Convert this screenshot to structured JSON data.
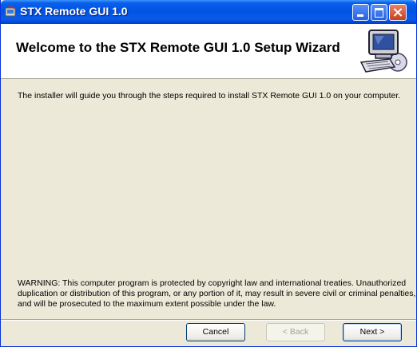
{
  "window": {
    "title": "STX Remote GUI 1.0",
    "icons": {
      "app": "installer-icon",
      "minimize": "minimize-icon",
      "maximize": "maximize-icon",
      "close": "close-icon"
    }
  },
  "banner": {
    "heading": "Welcome to the STX Remote GUI 1.0 Setup Wizard",
    "icon": "computer-setup-icon"
  },
  "body": {
    "intro": "The installer will guide you through the steps required to install STX Remote GUI 1.0 on your computer.",
    "warning": "WARNING: This computer program is protected by copyright law and international treaties. Unauthorized duplication or distribution of this program, or any portion of it, may result in severe civil or criminal penalties, and will be prosecuted to the maximum extent possible under the law."
  },
  "buttons": {
    "cancel": "Cancel",
    "back": "< Back",
    "next": "Next >"
  },
  "colors": {
    "titlebar": "#0054E3",
    "dialog_bg": "#ECE9D8",
    "banner_bg": "#FFFFFF",
    "disabled_text": "#A3A295"
  }
}
